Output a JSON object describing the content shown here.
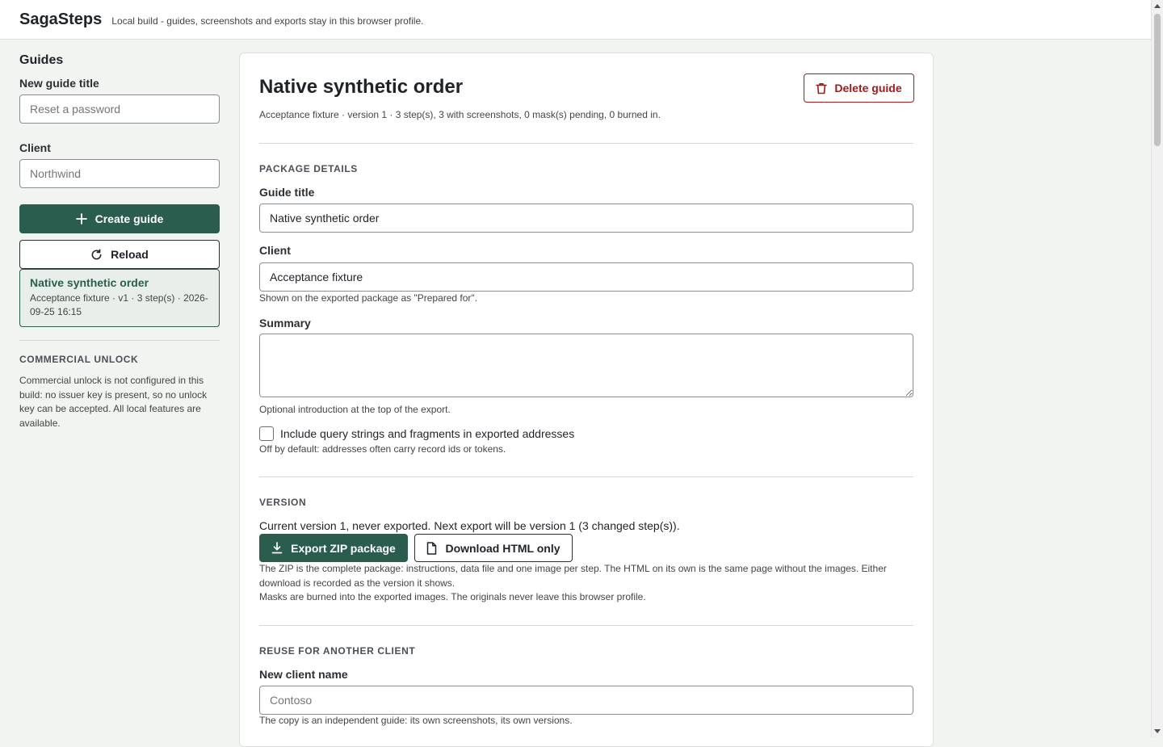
{
  "header": {
    "brand": "SagaSteps",
    "tagline": "Local build - guides, screenshots and exports stay in this browser profile."
  },
  "sidebar": {
    "heading": "Guides",
    "new_title_label": "New guide title",
    "new_title_placeholder": "Reset a password",
    "client_label": "Client",
    "client_placeholder": "Northwind",
    "create_label": "Create guide",
    "reload_label": "Reload",
    "guides": [
      {
        "title": "Native synthetic order",
        "meta": "Acceptance fixture · v1 · 3 step(s) · 2026-09-25 16:15"
      }
    ],
    "unlock_heading": "COMMERCIAL UNLOCK",
    "unlock_text": "Commercial unlock is not configured in this build: no issuer key is present, so no unlock key can be accepted. All local features are available."
  },
  "main": {
    "title": "Native synthetic order",
    "delete_label": "Delete guide",
    "subtitle": "Acceptance fixture · version 1 · 3 step(s), 3 with screenshots, 0 mask(s) pending, 0 burned in.",
    "package": {
      "heading": "PACKAGE DETAILS",
      "guide_title_label": "Guide title",
      "guide_title_value": "Native synthetic order",
      "client_label": "Client",
      "client_value": "Acceptance fixture",
      "client_help": "Shown on the exported package as \"Prepared for\".",
      "summary_label": "Summary",
      "summary_value": "",
      "summary_help": "Optional introduction at the top of the export.",
      "query_checkbox_label": "Include query strings and fragments in exported addresses",
      "query_checkbox_checked": false,
      "query_help": "Off by default: addresses often carry record ids or tokens."
    },
    "version": {
      "heading": "VERSION",
      "status": "Current version 1, never exported. Next export will be version 1 (3 changed step(s)).",
      "export_zip_label": "Export ZIP package",
      "download_html_label": "Download HTML only",
      "help_1": "The ZIP is the complete package: instructions, data file and one image per step. The HTML on its own is the same page without the images. Either download is recorded as the version it shows.",
      "help_2": "Masks are burned into the exported images. The originals never leave this browser profile."
    },
    "reuse": {
      "heading": "REUSE FOR ANOTHER CLIENT",
      "new_client_label": "New client name",
      "new_client_placeholder": "Contoso",
      "help": "The copy is an independent guide: its own screenshots, its own versions."
    }
  },
  "colors": {
    "accent": "#2b5d4f",
    "danger": "#a31a1a",
    "page_bg": "#f1f4f1"
  }
}
